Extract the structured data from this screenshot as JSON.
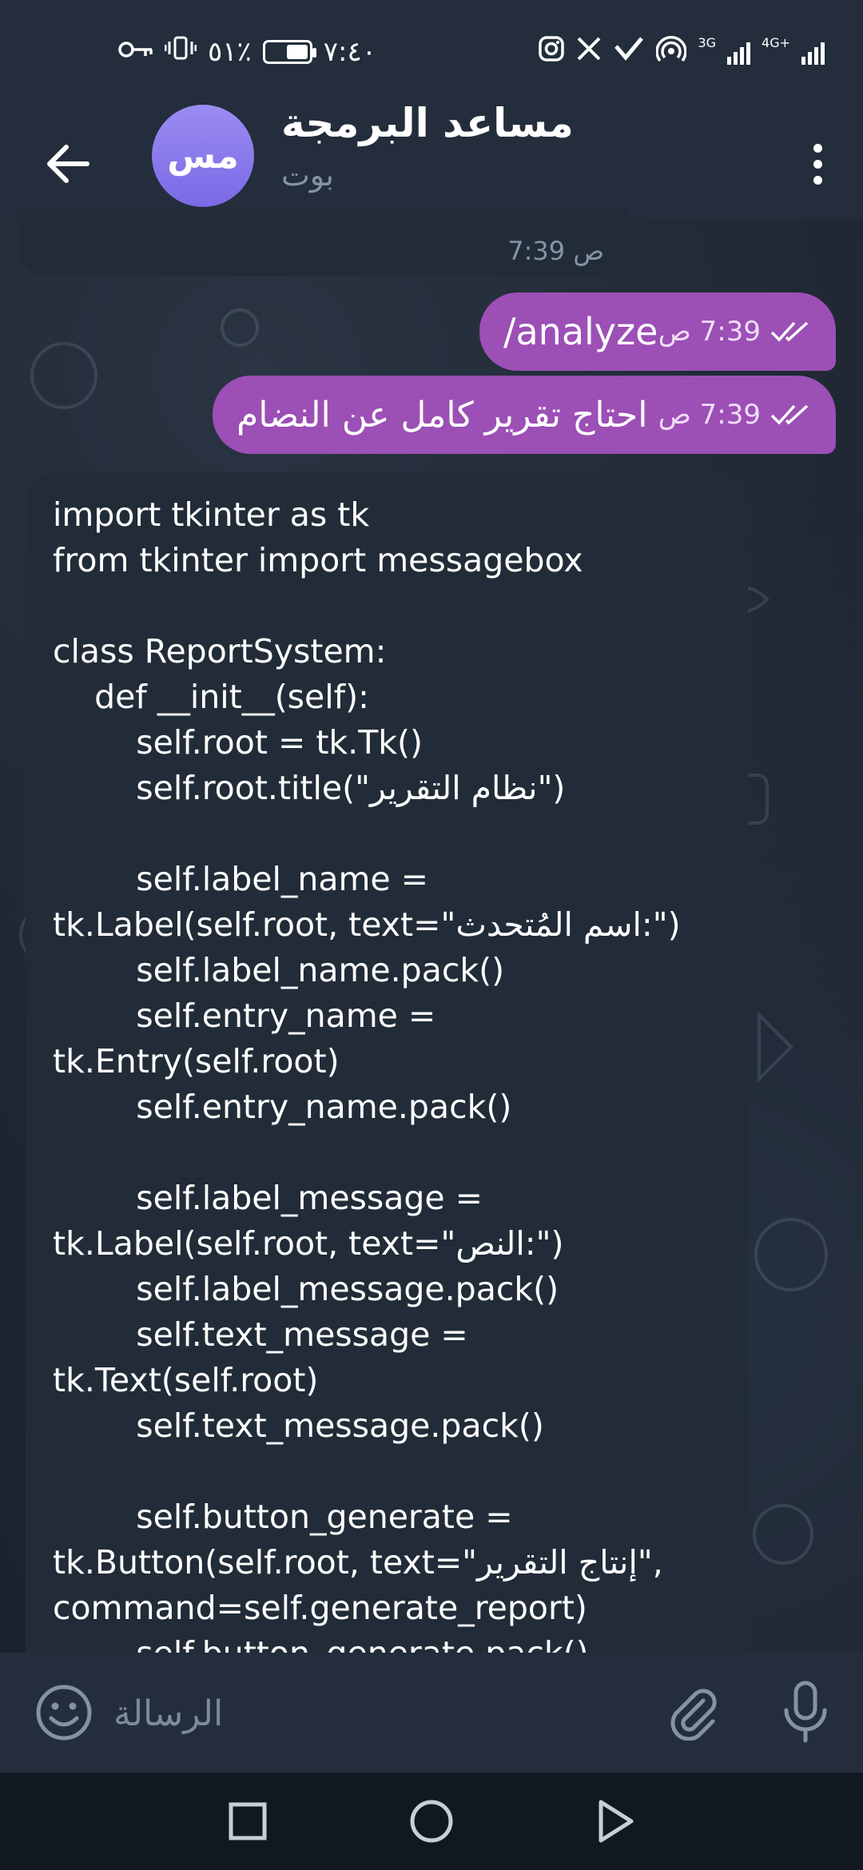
{
  "status_bar": {
    "time": "٧:٤٠",
    "battery": "٪٥١",
    "battery_level": 0.51,
    "network_1": "3G",
    "network_2": "4G+",
    "icons": [
      "vibrate-icon",
      "key-icon",
      "instagram-icon",
      "x-icon",
      "location-icon",
      "hotspot-icon",
      "signal-icon"
    ]
  },
  "header": {
    "avatar_initials": "مس",
    "title": "مساعد البرمجة",
    "subtitle": "بوت"
  },
  "messages": {
    "incoming_partial_time": "7:39 ص",
    "outgoing": [
      {
        "text": "/analyze",
        "time": "7:39 ص"
      },
      {
        "text": "احتاج تقرير كامل عن النضام",
        "time": "7:39 ص"
      }
    ],
    "code_message": "import tkinter as tk\nfrom tkinter import messagebox\n\nclass ReportSystem:\n    def __init__(self):\n        self.root = tk.Tk()\n        self.root.title(\"نظام التقرير\")\n\n        self.label_name =\ntk.Label(self.root, text=\"اسم المُتحدث:\")\n        self.label_name.pack()\n        self.entry_name =\ntk.Entry(self.root)\n        self.entry_name.pack()\n\n        self.label_message =\ntk.Label(self.root, text=\"النص:\")\n        self.label_message.pack()\n        self.text_message =\ntk.Text(self.root)\n        self.text_message.pack()\n\n        self.button_generate =\ntk.Button(self.root, text=\"إنتاج التقرير\",\ncommand=self.generate_report)\n        self.button_generate.pack()"
  },
  "input_bar": {
    "placeholder": "الرسالة"
  },
  "colors": {
    "header_bg": "#232d3b",
    "bubble_out": "#9c4fb5",
    "bubble_in": "#222c38",
    "avatar": "#8a7bed"
  }
}
